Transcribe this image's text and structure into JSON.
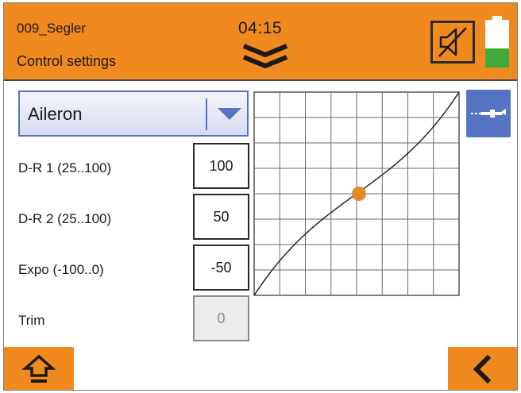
{
  "header": {
    "model_name": "009_Segler",
    "screen_title": "Control settings",
    "time": "04:15",
    "battery_level": 0.4,
    "accent_color": "#f0891e"
  },
  "function_select": {
    "selected": "Aileron",
    "color": "#5674c4"
  },
  "settings": [
    {
      "label": "D-R 1 (25..100)",
      "value": "100",
      "enabled": true
    },
    {
      "label": "D-R 2 (25..100)",
      "value": "50",
      "enabled": true
    },
    {
      "label": "Expo (-100..0)",
      "value": "-50",
      "enabled": true
    },
    {
      "label": "Trim",
      "value": "0",
      "enabled": false
    }
  ],
  "curve": {
    "grid_divisions": 8,
    "dual_rate": 100,
    "expo": -50,
    "marker_input": 0,
    "marker_color": "#e08a2a"
  },
  "icons": {
    "sound": "speaker-muted-icon",
    "mode_toggle": "aircraft-icon",
    "home": "home-icon",
    "back": "chevron-left-icon",
    "expand": "double-chevron-down-icon"
  }
}
